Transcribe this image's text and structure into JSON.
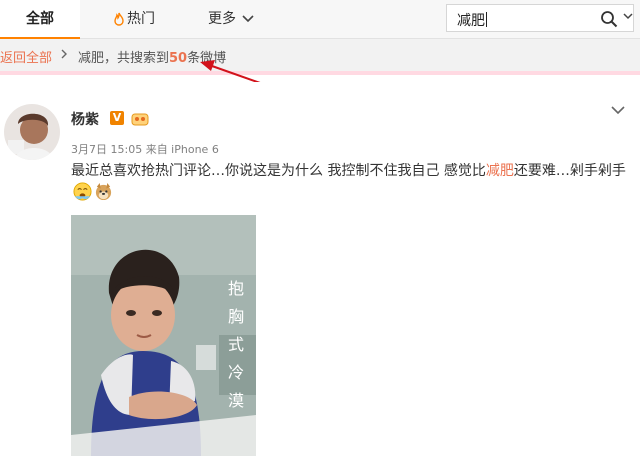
{
  "tabs": {
    "all": "全部",
    "hot": "热门",
    "more": "更多"
  },
  "search": {
    "value": "减肥"
  },
  "breadcrumb": {
    "back": "返回全部",
    "result_prefix": "减肥，共搜索到",
    "result_count": "50",
    "result_suffix": "条微博"
  },
  "post": {
    "author": "杨紫",
    "verified_badge": "V",
    "meta": "3月7日 15:05 来自 iPhone 6",
    "text_before": "最近总喜欢抢热门评论…你说这是为什么 我控制不住我自己 感觉比",
    "text_highlight": "减肥",
    "text_after": "还要难…剁手剁手",
    "image_caption": [
      "抱",
      "胸",
      "式",
      "冷",
      "漠"
    ]
  },
  "colors": {
    "accent": "#ff8200",
    "highlight": "#eb7350",
    "annotation_arrow": "#d2121b"
  },
  "icons": [
    "fire-icon",
    "chevron-down-icon",
    "search-icon",
    "verified-icon",
    "level-icon",
    "doge-emoji",
    "crying-emoji"
  ]
}
